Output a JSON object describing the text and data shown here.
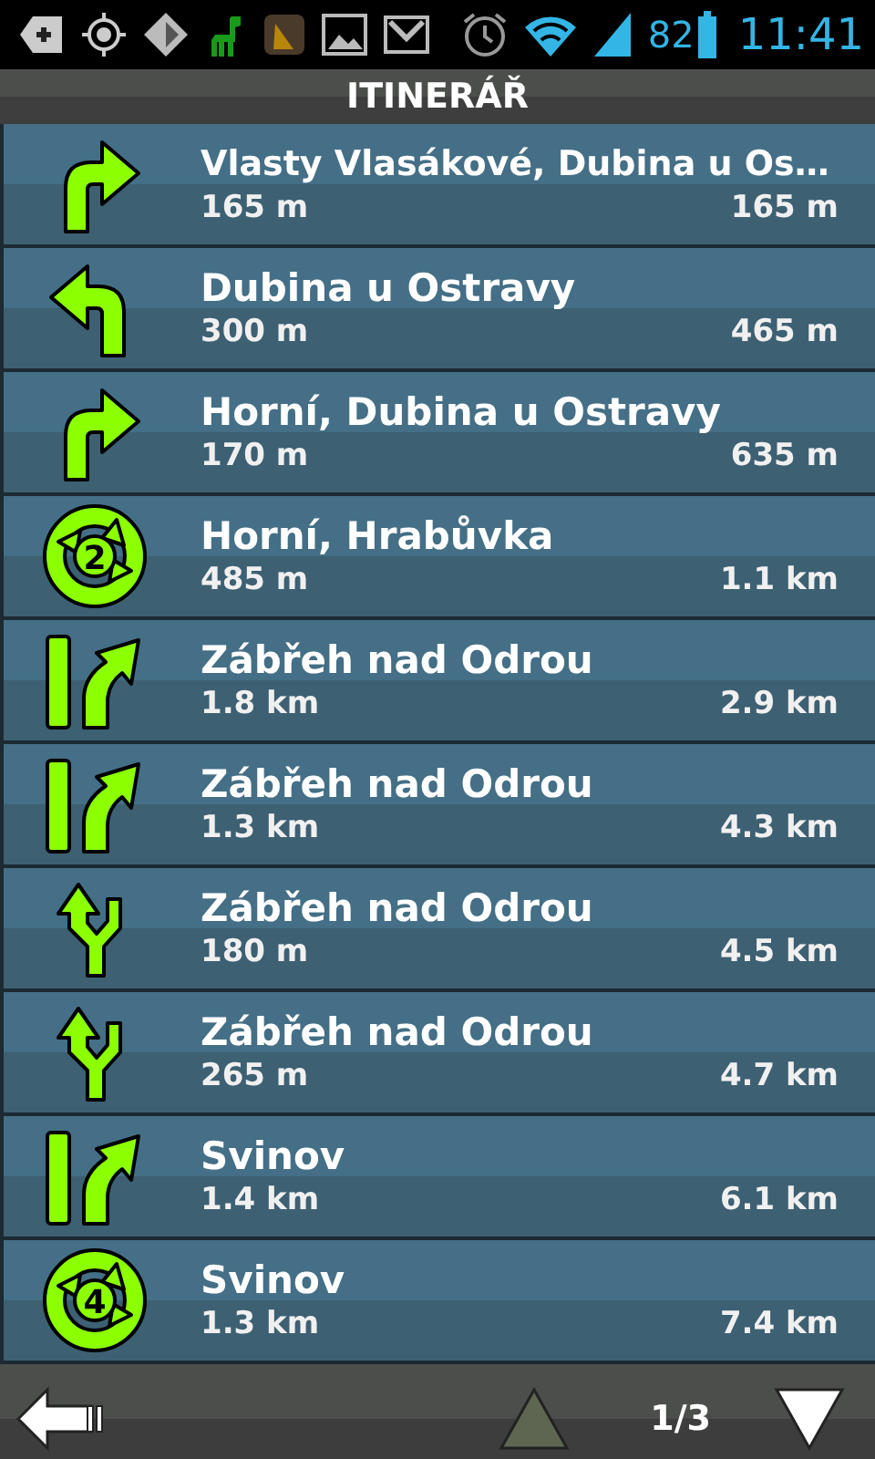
{
  "status_bar": {
    "battery": "82",
    "time": "11:41"
  },
  "title": "ITINERÁŘ",
  "steps": [
    {
      "kind": "turn-right",
      "street": "Vlasty Vlasákové, Dubina u Os…",
      "distance": "165 m",
      "total": "165 m"
    },
    {
      "kind": "turn-left",
      "street": "Dubina u Ostravy",
      "distance": "300 m",
      "total": "465 m"
    },
    {
      "kind": "turn-right",
      "street": "Horní, Dubina u Ostravy",
      "distance": "170 m",
      "total": "635 m"
    },
    {
      "kind": "roundabout",
      "exit": "2",
      "street": "Horní, Hrabůvka",
      "distance": "485 m",
      "total": "1.1 km"
    },
    {
      "kind": "keep-right",
      "street": "Zábřeh nad Odrou",
      "distance": "1.8 km",
      "total": "2.9 km"
    },
    {
      "kind": "keep-right",
      "street": "Zábřeh nad Odrou",
      "distance": "1.3 km",
      "total": "4.3 km"
    },
    {
      "kind": "fork-left",
      "street": "Zábřeh nad Odrou",
      "distance": "180 m",
      "total": "4.5 km"
    },
    {
      "kind": "fork-left",
      "street": "Zábřeh nad Odrou",
      "distance": "265 m",
      "total": "4.7 km"
    },
    {
      "kind": "keep-right",
      "street": "Svinov",
      "distance": "1.4 km",
      "total": "6.1 km"
    },
    {
      "kind": "roundabout",
      "exit": "4",
      "street": "Svinov",
      "distance": "1.3 km",
      "total": "7.4 km"
    }
  ],
  "footer": {
    "page": "1/3",
    "up_disabled": true,
    "down_disabled": false
  }
}
